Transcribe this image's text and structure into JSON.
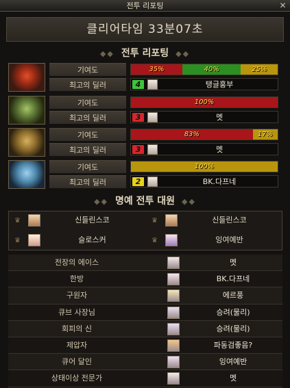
{
  "window": {
    "title": "전투 리포팅"
  },
  "clear_time": "클리어타임  33분07초",
  "report_title": "전투 리포팅",
  "labels": {
    "contribution": "기여도",
    "top_dealer": "최고의 딜러"
  },
  "teams": [
    {
      "icon": "flame-emblem-icon",
      "segments": [
        {
          "text": "35%",
          "value": 35,
          "color": "#a8151a"
        },
        {
          "text": "40%",
          "value": 40,
          "color": "#2c8f22"
        },
        {
          "text": "25%",
          "value": 25,
          "color": "#b8950c"
        }
      ],
      "dealer": {
        "rank": "4",
        "rank_color": "#3fc43a",
        "name": "탱글홍부"
      }
    },
    {
      "icon": "green-armor-icon",
      "segments": [
        {
          "text": "100%",
          "value": 100,
          "color": "#a8151a"
        }
      ],
      "dealer": {
        "rank": "3",
        "rank_color": "#d8252b",
        "name": "멧"
      }
    },
    {
      "icon": "gold-armor-icon",
      "segments": [
        {
          "text": "83%",
          "value": 83,
          "color": "#a8151a"
        },
        {
          "text": "17%",
          "value": 17,
          "color": "#b8950c"
        }
      ],
      "dealer": {
        "rank": "3",
        "rank_color": "#d8252b",
        "name": "멧"
      }
    },
    {
      "icon": "blue-armor-icon",
      "segments": [
        {
          "text": "100%",
          "value": 100,
          "color": "#b8950c"
        }
      ],
      "dealer": {
        "rank": "2",
        "rank_color": "#e6d21a",
        "name": "BK.다프네"
      }
    }
  ],
  "honor_title": "명예 전투 대원",
  "honor": [
    "신들린스코",
    "신들린스코",
    "슬로스커",
    "잉여예반"
  ],
  "awards": [
    {
      "category": "전장의 에이스",
      "name": "멧"
    },
    {
      "category": "한방",
      "name": "BK.다프네"
    },
    {
      "category": "구원자",
      "name": "에르풍"
    },
    {
      "category": "큐브 사장님",
      "name": "승려(물리)"
    },
    {
      "category": "회피의 신",
      "name": "승려(물리)"
    },
    {
      "category": "제압자",
      "name": "파동검좋음?"
    },
    {
      "category": "큐어 달인",
      "name": "잉여예반"
    },
    {
      "category": "상태이상 전문가",
      "name": "멧"
    }
  ]
}
